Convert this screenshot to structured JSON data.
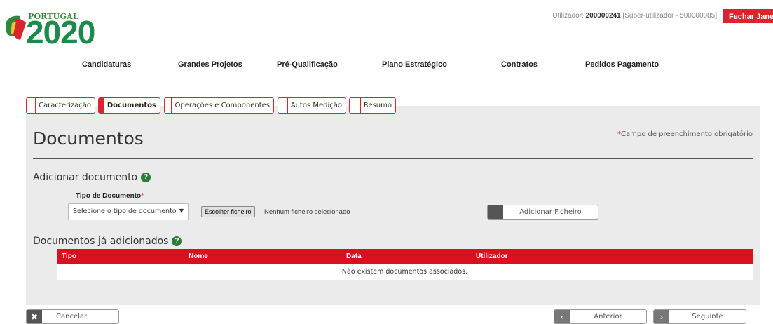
{
  "header": {
    "logo_country": "PORTUGAL",
    "logo_year": "2020",
    "user_prefix": "Utilizador:",
    "user_id": "200000241",
    "user_role": "[Super-utilizador - 500000085]",
    "close_label": "Fechar Janela"
  },
  "nav": [
    "Candidaturas",
    "Grandes Projetos",
    "Pré-Qualificação",
    "Plano Estratégico",
    "Contratos",
    "Pedidos Pagamento"
  ],
  "tabs": [
    {
      "label": "Caracterização",
      "active": false
    },
    {
      "label": "Documentos",
      "active": true
    },
    {
      "label": "Operações e Componentes",
      "active": false
    },
    {
      "label": "Autos Medição",
      "active": false
    },
    {
      "label": "Resumo",
      "active": false
    }
  ],
  "page": {
    "title": "Documentos",
    "required_star": "*",
    "required_note": "Campo de preenchimento obrigatório"
  },
  "add_section": {
    "title": "Adicionar documento",
    "field_label": "Tipo de Documento",
    "field_star": "*",
    "select_value": "Selecione o tipo de documento",
    "choose_file_label": "Escolher ficheiro",
    "file_status": "Nenhum ficheiro selecionado",
    "add_button_label": "Adicionar Ficheiro"
  },
  "list_section": {
    "title": "Documentos já adicionados",
    "columns": [
      "Tipo",
      "Nome",
      "Data",
      "Utilizador"
    ],
    "empty_message": "Não existem documentos associados."
  },
  "footer": {
    "cancel_label": "Cancelar",
    "prev_label": "Anterior",
    "next_label": "Seguinte"
  },
  "colors": {
    "accent": "#d9252e",
    "brand_green": "#1b8a4a",
    "panel_bg": "#ebebeb",
    "table_header": "#d9101e"
  },
  "icons": [
    "logo-mark",
    "help-icon",
    "close-x-icon",
    "chevron-left-icon",
    "chevron-right-icon",
    "caret-down-icon"
  ]
}
